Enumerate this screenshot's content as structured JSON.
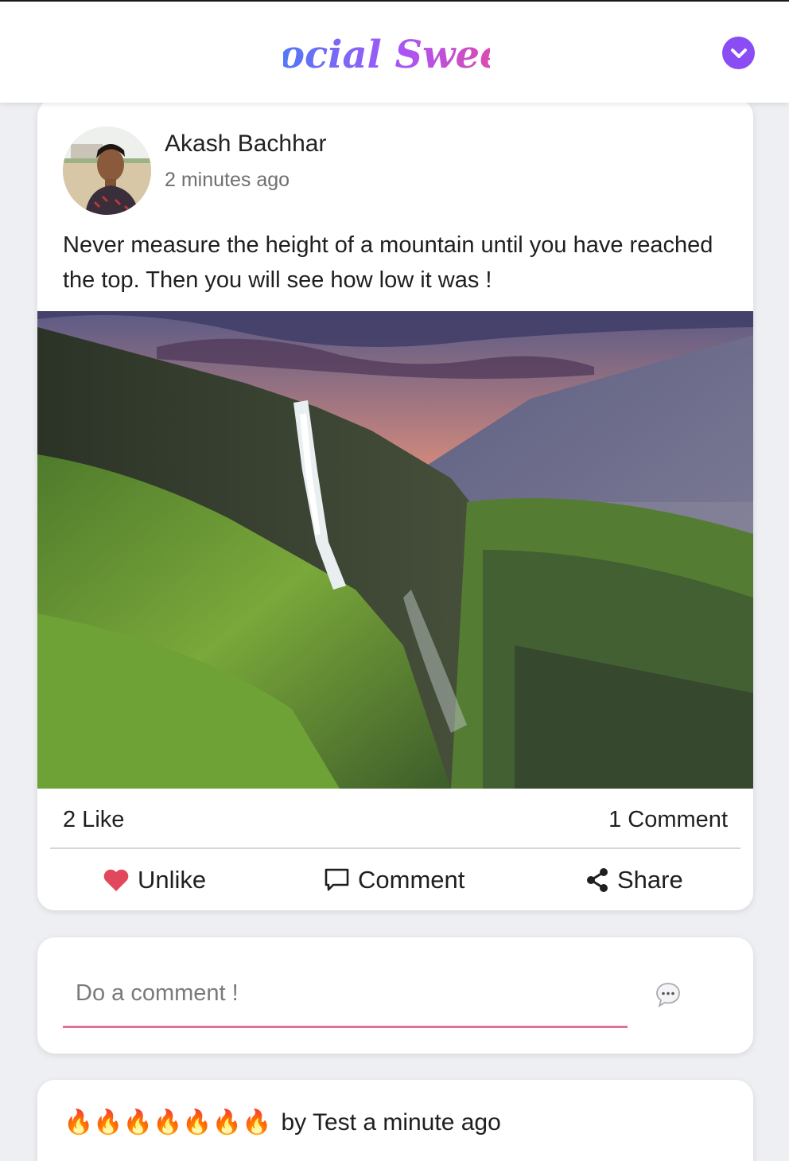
{
  "app": {
    "name": "Social Sweet",
    "brand_gradient": [
      "#3b82f6",
      "#a855f7",
      "#ec4899"
    ],
    "menu_color": "#8a4cf4"
  },
  "post": {
    "author": "Akash Bachhar",
    "time": "2 minutes ago",
    "text": "Never measure the height of a mountain until you have reached the top. Then you will see how low it was !",
    "like_count": "2 Like",
    "comment_count": "1 Comment",
    "actions": {
      "like_label": "Unlike",
      "comment_label": "Comment",
      "share_label": "Share"
    }
  },
  "comment_box": {
    "placeholder": "Do a comment !",
    "underline_color": "#e0709a"
  },
  "comments": [
    {
      "emoji": "🔥🔥🔥🔥🔥🔥🔥",
      "by_text": "by Test a minute ago"
    }
  ],
  "icons": {
    "menu": "chevron-down-icon",
    "like": "heart-icon",
    "comment": "speech-bubble-icon",
    "share": "share-icon",
    "send": "chat-bubble-icon",
    "fire": "fire-emoji-icon"
  }
}
